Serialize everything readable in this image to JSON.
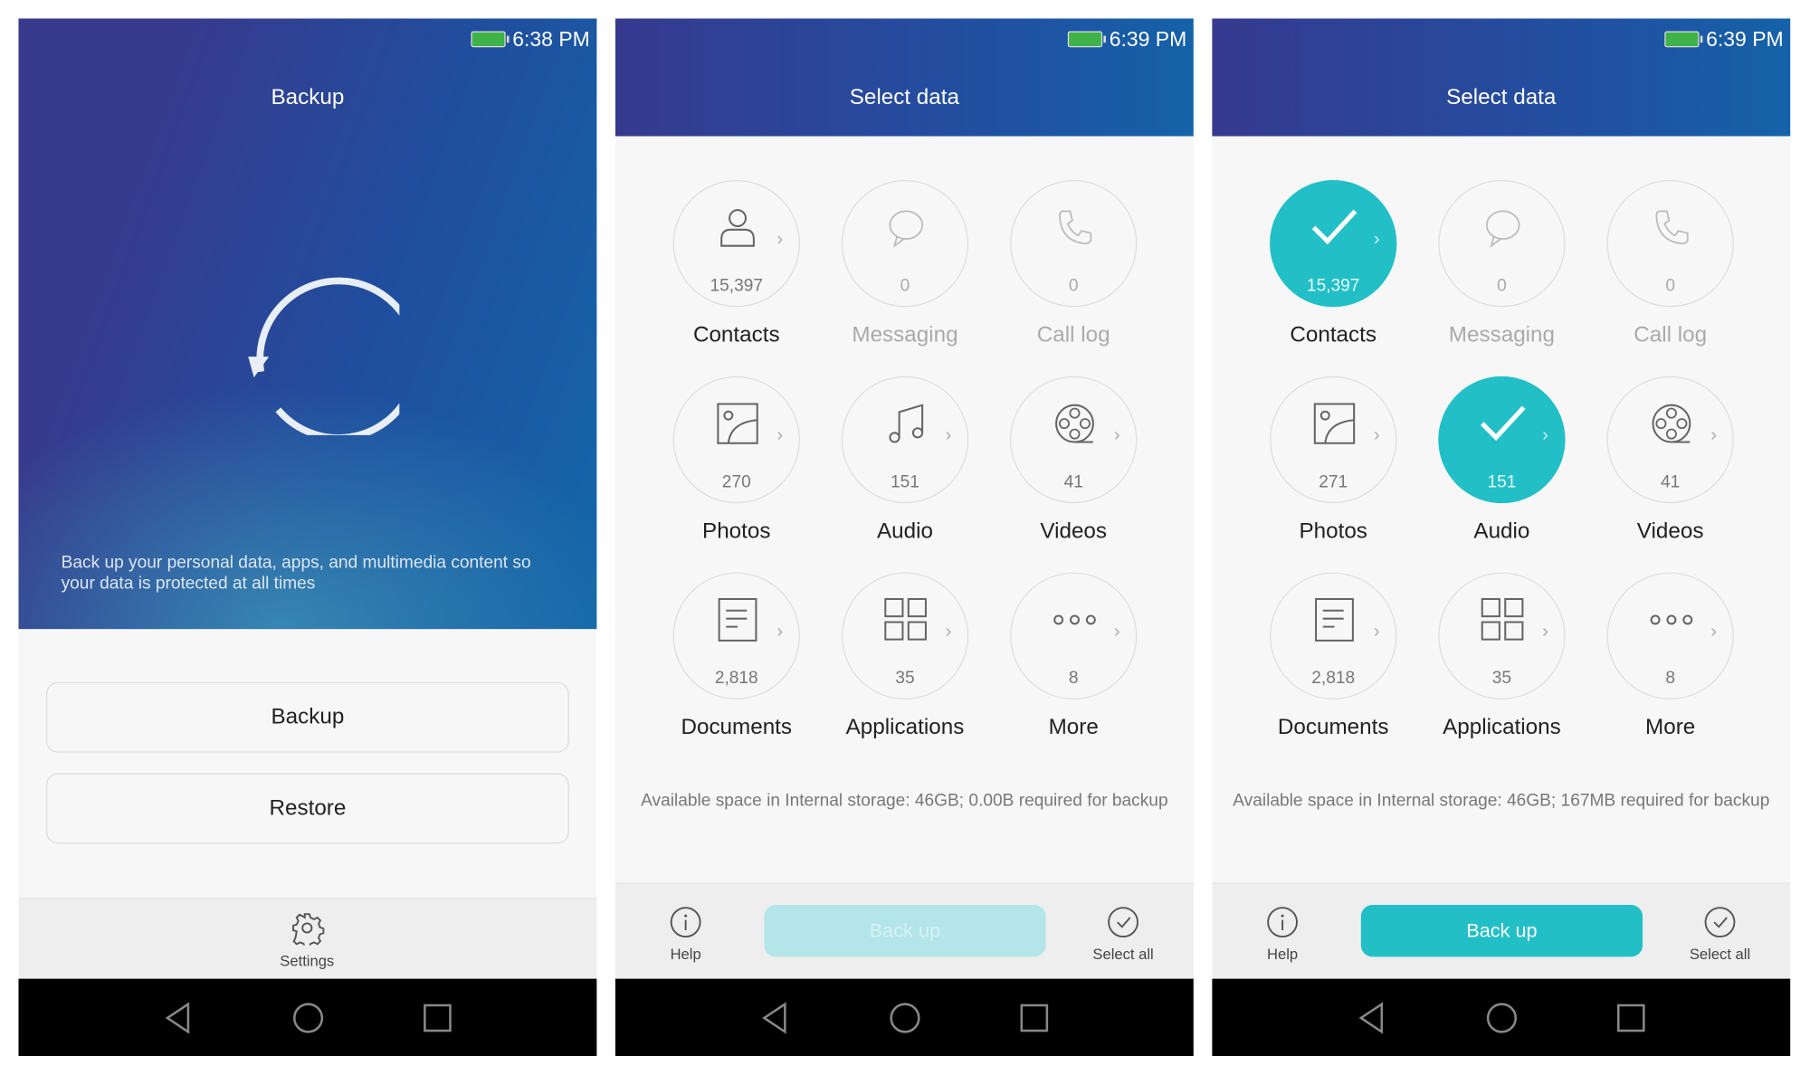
{
  "colors": {
    "accent": "#22bfc7",
    "accent_disabled": "#b3e5e9",
    "header_start": "#363a8f",
    "header_end": "#1562a8"
  },
  "screen1": {
    "time": "6:38 PM",
    "title": "Backup",
    "icon": "refresh-icon",
    "description": "Back up your personal data, apps, and multimedia content so your data is protected at all times",
    "backup_label": "Backup",
    "restore_label": "Restore",
    "settings_label": "Settings"
  },
  "screens": [
    {
      "time": "6:39 PM",
      "title": "Select data",
      "available": "Available space in Internal storage: 46GB; 0.00B required for backup",
      "help_label": "Help",
      "backup_label": "Back up",
      "backup_enabled": false,
      "select_all_label": "Select all",
      "items": [
        {
          "label": "Contacts",
          "count": "15,397",
          "icon": "contact-icon",
          "selected": false,
          "disabled": false
        },
        {
          "label": "Messaging",
          "count": "0",
          "icon": "message-icon",
          "selected": false,
          "disabled": true
        },
        {
          "label": "Call log",
          "count": "0",
          "icon": "phone-icon",
          "selected": false,
          "disabled": true
        },
        {
          "label": "Photos",
          "count": "270",
          "icon": "photo-icon",
          "selected": false,
          "disabled": false
        },
        {
          "label": "Audio",
          "count": "151",
          "icon": "music-icon",
          "selected": false,
          "disabled": false
        },
        {
          "label": "Videos",
          "count": "41",
          "icon": "film-reel-icon",
          "selected": false,
          "disabled": false
        },
        {
          "label": "Documents",
          "count": "2,818",
          "icon": "document-icon",
          "selected": false,
          "disabled": false
        },
        {
          "label": "Applications",
          "count": "35",
          "icon": "apps-grid-icon",
          "selected": false,
          "disabled": false
        },
        {
          "label": "More",
          "count": "8",
          "icon": "more-icon",
          "selected": false,
          "disabled": false
        }
      ]
    },
    {
      "time": "6:39 PM",
      "title": "Select data",
      "available": "Available space in Internal storage: 46GB; 167MB required for backup",
      "help_label": "Help",
      "backup_label": "Back up",
      "backup_enabled": true,
      "select_all_label": "Select all",
      "items": [
        {
          "label": "Contacts",
          "count": "15,397",
          "icon": "contact-icon",
          "selected": true,
          "disabled": false
        },
        {
          "label": "Messaging",
          "count": "0",
          "icon": "message-icon",
          "selected": false,
          "disabled": true
        },
        {
          "label": "Call log",
          "count": "0",
          "icon": "phone-icon",
          "selected": false,
          "disabled": true
        },
        {
          "label": "Photos",
          "count": "271",
          "icon": "photo-icon",
          "selected": false,
          "disabled": false
        },
        {
          "label": "Audio",
          "count": "151",
          "icon": "music-icon",
          "selected": true,
          "disabled": false
        },
        {
          "label": "Videos",
          "count": "41",
          "icon": "film-reel-icon",
          "selected": false,
          "disabled": false
        },
        {
          "label": "Documents",
          "count": "2,818",
          "icon": "document-icon",
          "selected": false,
          "disabled": false
        },
        {
          "label": "Applications",
          "count": "35",
          "icon": "apps-grid-icon",
          "selected": false,
          "disabled": false
        },
        {
          "label": "More",
          "count": "8",
          "icon": "more-icon",
          "selected": false,
          "disabled": false
        }
      ]
    }
  ]
}
